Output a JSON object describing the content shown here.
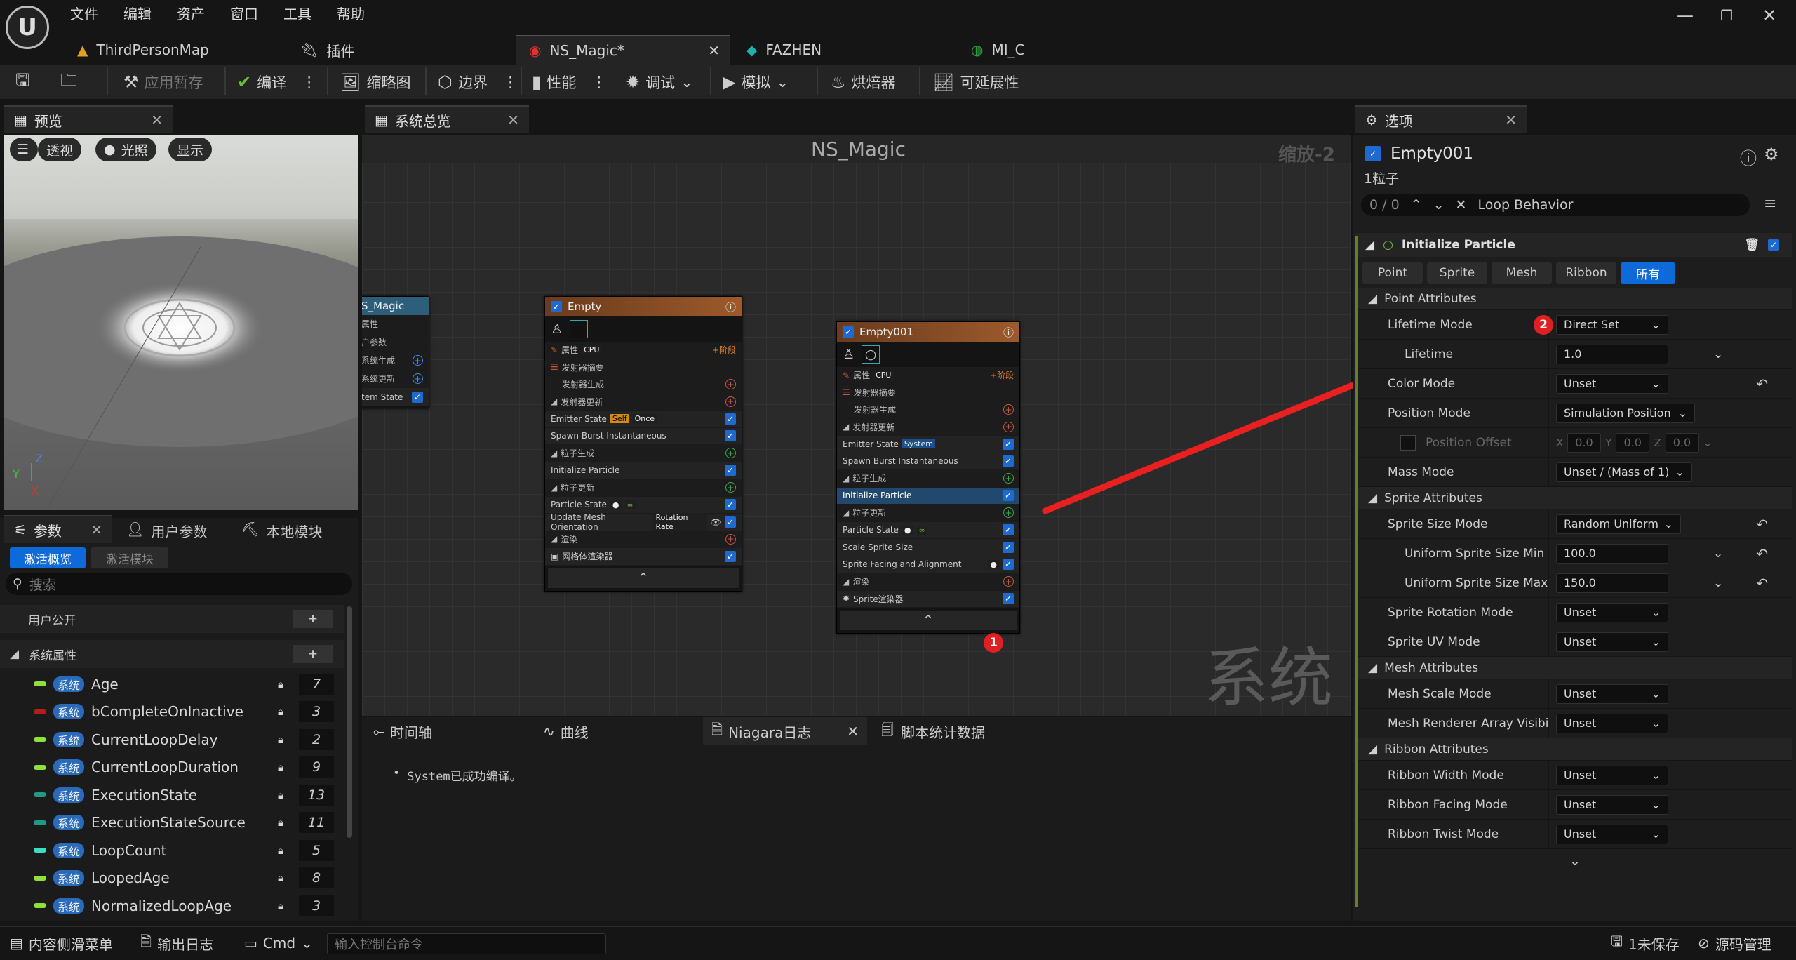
{
  "menu": [
    "文件",
    "编辑",
    "资产",
    "窗口",
    "工具",
    "帮助"
  ],
  "doc_tabs": [
    {
      "label": "ThirdPersonMap"
    },
    {
      "label": "插件"
    },
    {
      "label": "NS_Magic*"
    },
    {
      "label": "FAZHEN"
    },
    {
      "label": "MI_C"
    }
  ],
  "toolbar": {
    "apply": "应用暂存",
    "compile": "编译",
    "thumbnail": "缩略图",
    "bounds": "边界",
    "perf": "性能",
    "debug": "调试",
    "simulate": "模拟",
    "baker": "烘焙器",
    "scalability": "可延展性"
  },
  "preview": {
    "tab": "预览",
    "btn_persp": "透视",
    "btn_lit": "光照",
    "btn_show": "显示",
    "axis_z": "Z",
    "axis_x": "X",
    "axis_y": "Y"
  },
  "params": {
    "tabs": [
      "参数",
      "用户参数",
      "本地模块"
    ],
    "filter_active": "激活概览",
    "filter_module": "激活模块",
    "search_placeholder": "搜索",
    "user_public": "用户公开",
    "sys_attr": "系统属性",
    "sys_tag": "系统",
    "rows": [
      {
        "name": "Age",
        "value": "7",
        "color": "#8fe03c"
      },
      {
        "name": "bCompleteOnInactive",
        "value": "3",
        "color": "#b41c1c"
      },
      {
        "name": "CurrentLoopDelay",
        "value": "2",
        "color": "#8fe03c"
      },
      {
        "name": "CurrentLoopDuration",
        "value": "9",
        "color": "#8fe03c"
      },
      {
        "name": "ExecutionState",
        "value": "13",
        "color": "#1e9a86"
      },
      {
        "name": "ExecutionStateSource",
        "value": "11",
        "color": "#1e9a86"
      },
      {
        "name": "LoopCount",
        "value": "5",
        "color": "#3ce0c0"
      },
      {
        "name": "LoopedAge",
        "value": "8",
        "color": "#8fe03c"
      },
      {
        "name": "NormalizedLoopAge",
        "value": "3",
        "color": "#8fe03c"
      }
    ]
  },
  "graph": {
    "tab": "系统总览",
    "title": "NS_Magic",
    "zoom": "缩放-2",
    "watermark": "系统",
    "sys_node": {
      "title": "S_Magic",
      "rows": [
        "属性",
        "户参数",
        "系统生成",
        "系统更新",
        "tem State"
      ]
    },
    "empty": {
      "title": "Empty",
      "props": "属性",
      "cpu": "CPU",
      "stage": "阶段",
      "emitter_summary": "发射器摘要",
      "emitter_spawn": "发射器生成",
      "emitter_update": "发射器更新",
      "emitter_state": "Emitter State",
      "self": "Self",
      "once": "Once",
      "spawn_burst": "Spawn Burst Instantaneous",
      "particle_spawn": "粒子生成",
      "init": "Initialize Particle",
      "particle_update": "粒子更新",
      "particle_state": "Particle State",
      "update_mesh": "Update Mesh Orientation",
      "rotation_rate": "Rotation Rate",
      "render": "渲染",
      "mesh_renderer": "网格体渲染器"
    },
    "empty001": {
      "title": "Empty001",
      "props": "属性",
      "cpu": "CPU",
      "stage": "阶段",
      "emitter_summary": "发射器摘要",
      "emitter_spawn": "发射器生成",
      "emitter_update": "发射器更新",
      "emitter_state": "Emitter State",
      "system": "System",
      "spawn_burst": "Spawn Burst Instantaneous",
      "particle_spawn": "粒子生成",
      "init": "Initialize Particle",
      "particle_update": "粒子更新",
      "particle_state": "Particle State",
      "scale_sprite": "Scale Sprite Size",
      "sprite_facing": "Sprite Facing and Alignment",
      "render": "渲染",
      "sprite_renderer": "Sprite渲染器"
    },
    "badge1": "1",
    "badge2": "2"
  },
  "log": {
    "tabs": [
      "时间轴",
      "曲线",
      "Niagara日志",
      "脚本统计数据"
    ],
    "message": "System已成功编译。"
  },
  "details": {
    "tab": "选项",
    "emitter": "Empty001",
    "count": "1粒子",
    "search_count": "0 / 0",
    "search_value": "Loop Behavior",
    "module": "Initialize Particle",
    "filters": [
      "Point",
      "Sprite",
      "Mesh",
      "Ribbon",
      "所有"
    ],
    "cat_point": "Point Attributes",
    "cat_sprite": "Sprite Attributes",
    "cat_mesh": "Mesh Attributes",
    "cat_ribbon": "Ribbon Attributes",
    "lifetime_mode": "Lifetime Mode",
    "lifetime_mode_val": "Direct Set",
    "lifetime": "Lifetime",
    "lifetime_val": "1.0",
    "color_mode": "Color Mode",
    "color_mode_val": "Unset",
    "position_mode": "Position Mode",
    "position_mode_val": "Simulation Position",
    "position_offset": "Position Offset",
    "x": "X",
    "y": "Y",
    "z": "Z",
    "xv": "0.0",
    "yv": "0.0",
    "zv": "0.0",
    "mass_mode": "Mass Mode",
    "mass_mode_val": "Unset / (Mass of 1)",
    "sprite_size_mode": "Sprite Size Mode",
    "sprite_size_mode_val": "Random Uniform",
    "sprite_min": "Uniform Sprite Size Min",
    "sprite_min_val": "100.0",
    "sprite_max": "Uniform Sprite Size Max",
    "sprite_max_val": "150.0",
    "sprite_rot": "Sprite Rotation Mode",
    "sprite_rot_val": "Unset",
    "sprite_uv": "Sprite UV Mode",
    "sprite_uv_val": "Unset",
    "mesh_scale": "Mesh Scale Mode",
    "mesh_scale_val": "Unset",
    "mesh_vis": "Mesh Renderer Array Visibility M",
    "mesh_vis_val": "Unset",
    "ribbon_width": "Ribbon Width Mode",
    "ribbon_width_val": "Unset",
    "ribbon_facing": "Ribbon Facing Mode",
    "ribbon_facing_val": "Unset",
    "ribbon_twist": "Ribbon Twist Mode",
    "ribbon_twist_val": "Unset"
  },
  "bottom": {
    "drawer": "内容侧滑菜单",
    "output": "输出日志",
    "cmd": "Cmd",
    "cmd_placeholder": "输入控制台命令",
    "unsaved": "1未保存",
    "source": "源码管理"
  }
}
